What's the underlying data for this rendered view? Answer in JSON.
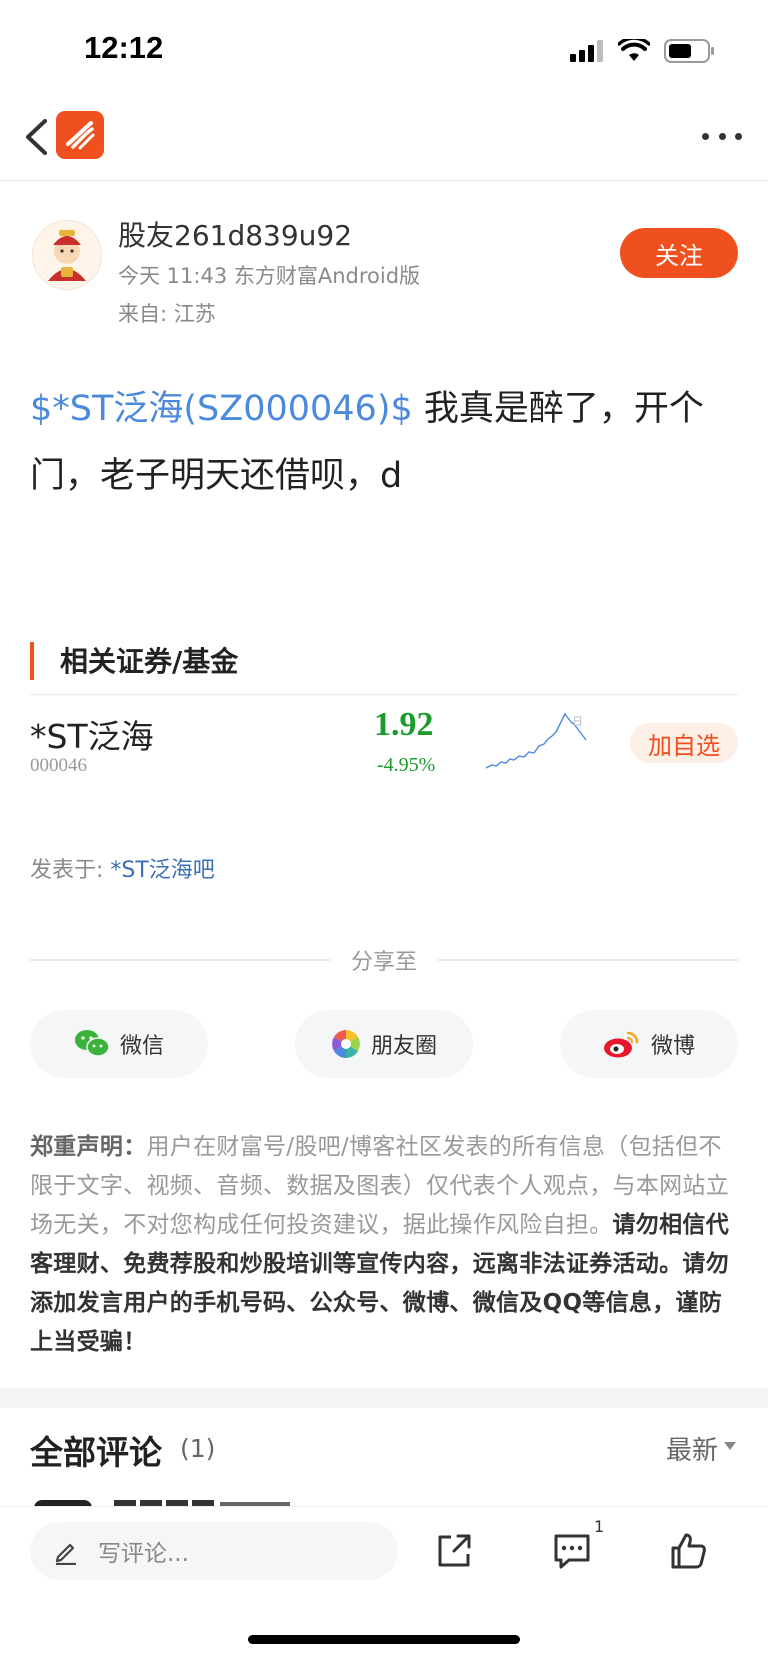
{
  "status_bar": {
    "time": "12:12",
    "icons": [
      "signal-icon",
      "wifi-icon",
      "battery-icon"
    ]
  },
  "nav": {
    "back_icon": "chevron-left-icon",
    "logo_icon": "eastmoney-logo-icon",
    "more_icon": "more-dots-icon"
  },
  "author": {
    "name": "股友261d839u92",
    "meta": "今天 11:43 东方财富Android版",
    "location": "来自: 江苏",
    "follow_label": "关注"
  },
  "post": {
    "tag": "$*ST泛海(SZ000046)$",
    "text": " 我真是醉了，开个门，老子明天还借呗，d"
  },
  "related": {
    "title": "相关证券/基金",
    "stock": {
      "name": "*ST泛海",
      "code": "000046",
      "price": "1.92",
      "change": "-4.95%",
      "spark_label": "日",
      "add_label": "加自选"
    }
  },
  "published": {
    "label": "发表于: ",
    "bar": "*ST泛海吧"
  },
  "share": {
    "title": "分享至",
    "buttons": [
      {
        "label": "微信",
        "icon": "wechat-icon"
      },
      {
        "label": "朋友圈",
        "icon": "moments-icon"
      },
      {
        "label": "微博",
        "icon": "weibo-icon"
      }
    ]
  },
  "disclaimer": {
    "lead": "郑重声明：",
    "normal": "用户在财富号/股吧/博客社区发表的所有信息（包括但不限于文字、视频、音频、数据及图表）仅代表个人观点，与本网站立场无关，不对您构成任何投资建议，据此操作风险自担。",
    "warning": "请勿相信代客理财、免费荐股和炒股培训等宣传内容，远离非法证券活动。请勿添加发言用户的手机号码、公众号、微博、微信及QQ等信息，谨防上当受骗！"
  },
  "comments": {
    "title": "全部评论",
    "count": "(1)",
    "sort": "最新"
  },
  "bottom_bar": {
    "placeholder": "写评论...",
    "comment_badge": "1"
  },
  "colors": {
    "accent": "#f0501e",
    "link": "#4a89dc",
    "down_green": "#1a9c2a"
  }
}
